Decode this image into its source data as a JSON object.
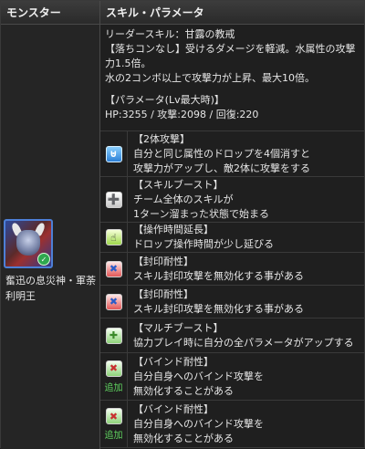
{
  "header": {
    "monster": "モンスター",
    "skill": "スキル・パラメータ"
  },
  "monster": {
    "name": "奮迅の息災神・軍荼利明王"
  },
  "leader": {
    "title": "リーダースキル：甘露の教戒",
    "line1": "【落ちコンなし】受けるダメージを軽減。水属性の攻撃力1.5倍。",
    "line2": "水の2コンボ以上で攻撃力が上昇、最大10倍。",
    "param_title": "【パラメータ(Lv最大時)】",
    "params": "HP:3255 / 攻撃:2098 / 回復:220"
  },
  "awakenings": [
    {
      "icon": "two-way-attack-icon",
      "title": "【2体攻撃】",
      "desc": [
        "自分と同じ属性のドロップを4個消すと",
        "攻撃力がアップし、敵2体に攻撃をする"
      ],
      "add": ""
    },
    {
      "icon": "skill-boost-icon",
      "title": "【スキルブースト】",
      "desc": [
        "チーム全体のスキルが",
        "1ターン溜まった状態で始まる"
      ],
      "add": ""
    },
    {
      "icon": "extend-time-icon",
      "title": "【操作時間延長】",
      "desc": [
        "ドロップ操作時間が少し延びる"
      ],
      "add": ""
    },
    {
      "icon": "skill-bind-resist-icon",
      "title": "【封印耐性】",
      "desc": [
        "スキル封印攻撃を無効化する事がある"
      ],
      "add": ""
    },
    {
      "icon": "skill-bind-resist-icon",
      "title": "【封印耐性】",
      "desc": [
        "スキル封印攻撃を無効化する事がある"
      ],
      "add": ""
    },
    {
      "icon": "multi-boost-icon",
      "title": "【マルチブースト】",
      "desc": [
        "協力プレイ時に自分の全パラメータがアップする"
      ],
      "add": ""
    },
    {
      "icon": "bind-resist-icon",
      "title": "【バインド耐性】",
      "desc": [
        "自分自身へのバインド攻撃を",
        "無効化することがある"
      ],
      "add": "追加"
    },
    {
      "icon": "bind-resist-icon",
      "title": "【バインド耐性】",
      "desc": [
        "自分自身へのバインド攻撃を",
        "無効化することがある"
      ],
      "add": "追加"
    }
  ]
}
